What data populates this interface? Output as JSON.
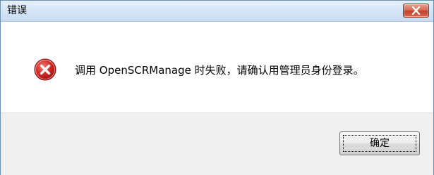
{
  "window": {
    "title": "错误",
    "close_icon": "close-icon"
  },
  "dialog": {
    "icon": "error-icon",
    "message": "调用 OpenSCRManage 时失败，请确认用管理员身份登录。"
  },
  "buttons": {
    "ok_label": "确定"
  },
  "colors": {
    "title_bar": "#d7e6f7",
    "close_button": "#c2412a",
    "error_icon": "#c8191d",
    "footer_background": "#f0f0f0"
  }
}
